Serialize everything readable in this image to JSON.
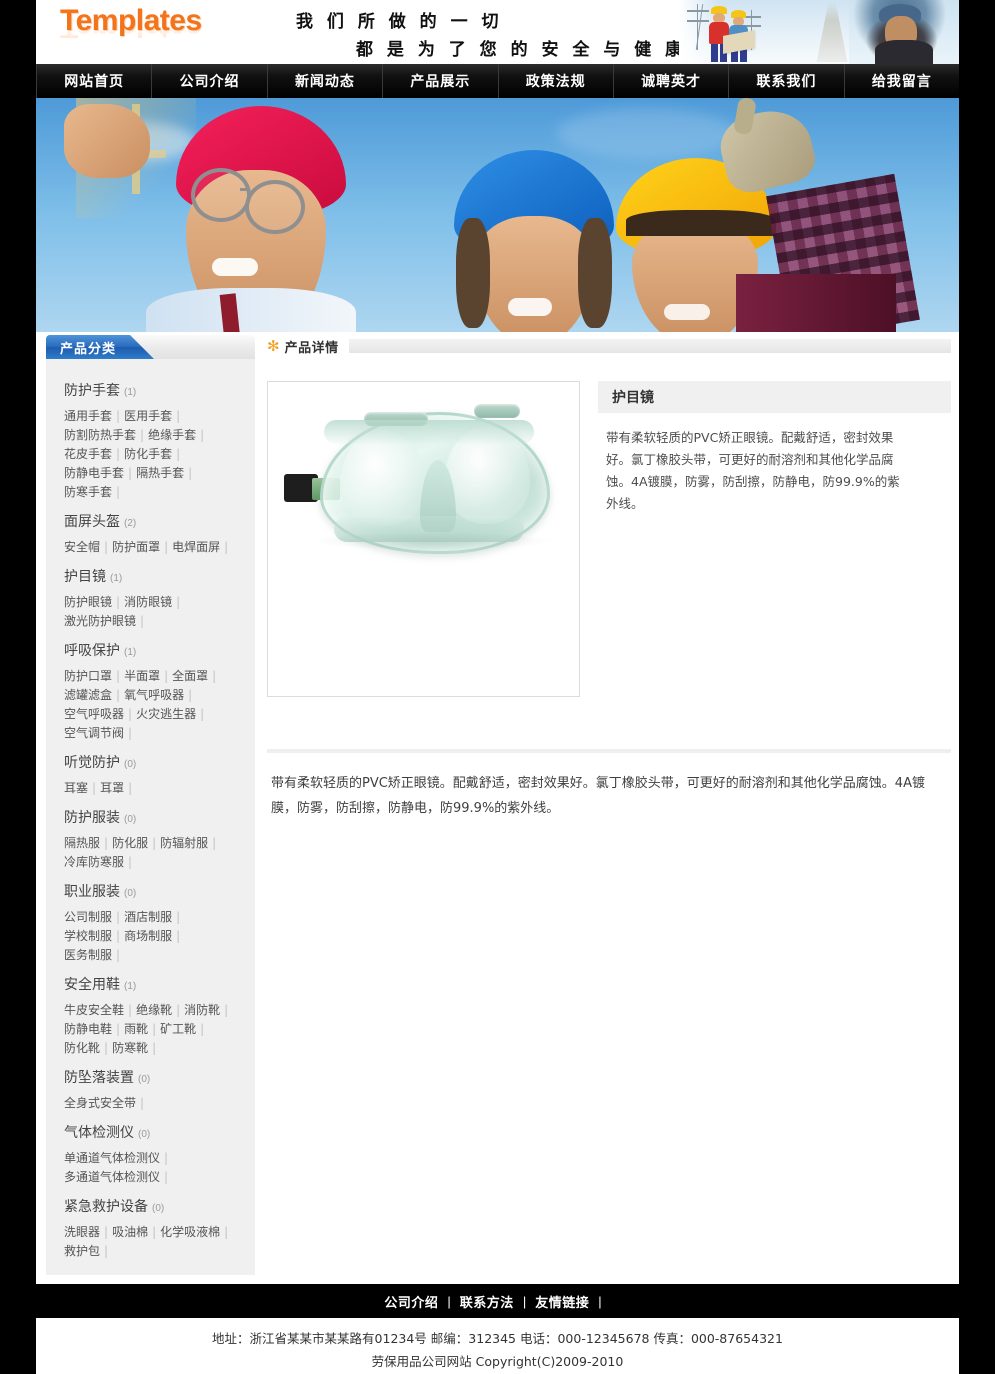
{
  "header": {
    "logo": "Templates",
    "slogan_line1": "我 们 所 做 的 一 切",
    "slogan_line2": "都 是 为 了 您 的 安 全 与 健 康"
  },
  "nav": {
    "items": [
      {
        "label": "网站首页"
      },
      {
        "label": "公司介绍"
      },
      {
        "label": "新闻动态"
      },
      {
        "label": "产品展示"
      },
      {
        "label": "政策法规"
      },
      {
        "label": "诚聘英才"
      },
      {
        "label": "联系我们"
      },
      {
        "label": "给我留言"
      }
    ]
  },
  "sidebar": {
    "title": "产品分类",
    "groups": [
      {
        "title": "防护手套",
        "count": "(1)",
        "links": [
          "通用手套",
          "医用手套",
          "防割防热手套",
          "绝缘手套",
          "花皮手套",
          "防化手套",
          "防静电手套",
          "隔热手套",
          "防寒手套"
        ]
      },
      {
        "title": "面屏头盔",
        "count": "(2)",
        "links": [
          "安全帽",
          "防护面罩",
          "电焊面屏"
        ]
      },
      {
        "title": "护目镜",
        "count": "(1)",
        "links": [
          "防护眼镜",
          "消防眼镜",
          "激光防护眼镜"
        ]
      },
      {
        "title": "呼吸保护",
        "count": "(1)",
        "links": [
          "防护口罩",
          "半面罩",
          "全面罩",
          "滤罐滤盒",
          "氧气呼吸器",
          "空气呼吸器",
          "火灾逃生器",
          "空气调节阀"
        ]
      },
      {
        "title": "听觉防护",
        "count": "(0)",
        "links": [
          "耳塞",
          "耳罩"
        ]
      },
      {
        "title": "防护服装",
        "count": "(0)",
        "links": [
          "隔热服",
          "防化服",
          "防辐射服",
          "冷库防寒服"
        ]
      },
      {
        "title": "职业服装",
        "count": "(0)",
        "links": [
          "公司制服",
          "酒店制服",
          "学校制服",
          "商场制服",
          "医务制服"
        ]
      },
      {
        "title": "安全用鞋",
        "count": "(1)",
        "links": [
          "牛皮安全鞋",
          "绝缘靴",
          "消防靴",
          "防静电鞋",
          "雨靴",
          "矿工靴",
          "防化靴",
          "防寒靴"
        ]
      },
      {
        "title": "防坠落装置",
        "count": "(0)",
        "links": [
          "全身式安全带"
        ]
      },
      {
        "title": "气体检测仪",
        "count": "(0)",
        "links": [
          "单通道气体检测仪",
          "多通道气体检测仪"
        ]
      },
      {
        "title": "紧急救护设备",
        "count": "(0)",
        "links": [
          "洗眼器",
          "吸油棉",
          "化学吸液棉",
          "救护包"
        ]
      }
    ]
  },
  "content": {
    "section_title": "产品详情",
    "product": {
      "name": "护目镜",
      "summary": "带有柔软轻质的PVC矫正眼镜。配戴舒适，密封效果好。氯丁橡胶头带，可更好的耐溶剂和其他化学品腐蚀。4A镀膜，防雾，防刮擦，防静电，防99.9%的紫外线。",
      "detail": "带有柔软轻质的PVC矫正眼镜。配戴舒适，密封效果好。氯丁橡胶头带，可更好的耐溶剂和其他化学品腐蚀。4A镀膜，防雾，防刮擦，防静电，防99.9%的紫外线。"
    }
  },
  "footer": {
    "links": [
      "公司介绍",
      "联系方法",
      "友情链接"
    ],
    "separator": "|",
    "address_line": "地址：浙江省某某市某某路有01234号  邮编：312345 电话：000-12345678 传真：000-87654321",
    "copyright_line": "劳保用品公司网站  Copyright(C)2009-2010"
  },
  "colors": {
    "accent_orange": "#f3741b",
    "nav_black": "#000000",
    "sidebar_blue": "#2a6cbd",
    "sidebar_bg": "#f0f0f0",
    "star": "#f0a022"
  },
  "icons": {
    "star": "✻"
  }
}
